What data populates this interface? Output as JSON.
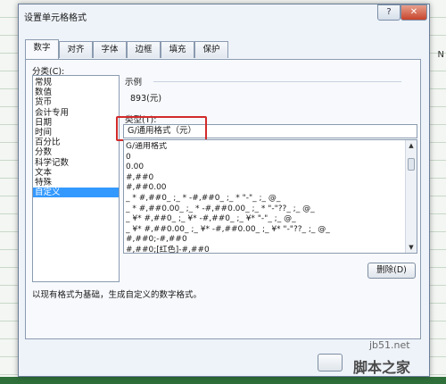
{
  "background": {
    "right_letter": "N"
  },
  "window": {
    "title": "设置单元格格式",
    "help_label": "?",
    "close_label": "✕"
  },
  "tabs": [
    {
      "label": "数字",
      "active": true
    },
    {
      "label": "对齐",
      "active": false
    },
    {
      "label": "字体",
      "active": false
    },
    {
      "label": "边框",
      "active": false
    },
    {
      "label": "填充",
      "active": false
    },
    {
      "label": "保护",
      "active": false
    }
  ],
  "category": {
    "label": "分类(C):",
    "items": [
      "常规",
      "数值",
      "货币",
      "会计专用",
      "日期",
      "时间",
      "百分比",
      "分数",
      "科学记数",
      "文本",
      "特殊",
      "自定义"
    ],
    "selected": "自定义"
  },
  "sample": {
    "label": "示例",
    "value": "893(元)"
  },
  "type": {
    "label": "类型(T):",
    "value": "G/通用格式（元）"
  },
  "formats": [
    "G/通用格式",
    "0",
    "0.00",
    "#,##0",
    "#,##0.00",
    "_ * #,##0_ ;_ * -#,##0_ ;_ * \"-\"_ ;_ @_",
    "_ * #,##0.00_ ;_ * -#,##0.00_ ;_ * \"-\"??_ ;_ @_",
    "_ ¥* #,##0_ ;_ ¥* -#,##0_ ;_ ¥* \"-\"_ ;_ @_",
    "_ ¥* #,##0.00_ ;_ ¥* -#,##0.00_ ;_ ¥* \"-\"??_ ;_ @_",
    "#,##0;-#,##0",
    "#,##0;[红色]-#,##0"
  ],
  "buttons": {
    "delete": "删除(D)"
  },
  "description": "以现有格式为基础，生成自定义的数字格式。",
  "watermark": {
    "site": "jb51.net",
    "name": "脚本之家"
  }
}
